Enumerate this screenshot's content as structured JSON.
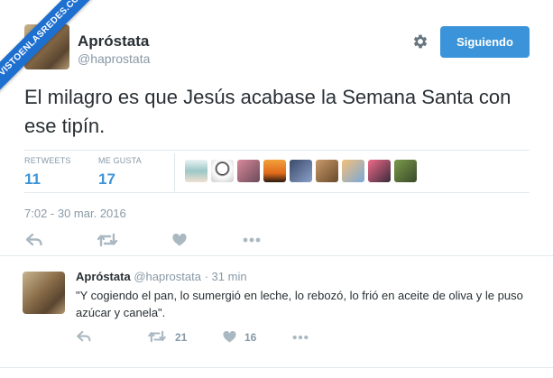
{
  "watermark": {
    "text": "VISTOENLASREDES.COM"
  },
  "tweet": {
    "display_name": "Apróstata",
    "handle": "@haprostata",
    "follow_label": "Siguiendo",
    "text": "El milagro es que Jesús acabase la Semana Santa con ese tipín.",
    "stats": {
      "retweets_label": "RETWEETS",
      "retweets_value": "11",
      "likes_label": "ME GUSTA",
      "likes_value": "17"
    },
    "timestamp": "7:02 - 30 mar. 2016"
  },
  "reply": {
    "display_name": "Apróstata",
    "handle": "@haprostata",
    "time_sep": "·",
    "time": "31 min",
    "text": "\"Y cogiendo el pan, lo sumergió en leche, lo rebozó, lo frió en aceite de oliva y le puso azúcar y canela\".",
    "retweet_count": "21",
    "like_count": "16"
  },
  "colors": {
    "accent": "#3b94d9",
    "muted": "#8899a6",
    "text": "#292f33",
    "border": "#e1e8ed"
  }
}
